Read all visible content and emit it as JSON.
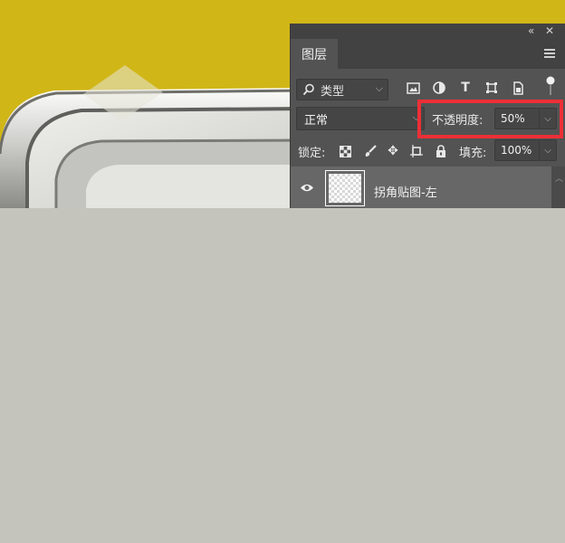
{
  "panel": {
    "collapse_icon": "double-chevron-icon",
    "close_icon": "close-icon",
    "tab_label": "图层",
    "menu_icon": "hamburger-menu-icon"
  },
  "filter": {
    "kind_label": "类型",
    "icons": [
      "image-filter-icon",
      "adjustment-filter-icon",
      "type-filter-icon",
      "shape-filter-icon",
      "smart-object-filter-icon",
      "filter-toggle-icon"
    ]
  },
  "blend": {
    "mode": "正常",
    "opacity_label": "不透明度:",
    "opacity_value": "50%"
  },
  "lock": {
    "label": "锁定:",
    "icons": [
      "lock-transparent-pixels-icon",
      "lock-image-pixels-icon",
      "lock-position-icon",
      "lock-artboard-icon",
      "lock-all-icon"
    ],
    "fill_label": "填充:",
    "fill_value": "100%"
  },
  "layers": [
    {
      "name": "拐角贴图-左",
      "visible": true
    }
  ],
  "colors": {
    "canvas_bg": "#d1b617",
    "panel_bg": "#535353",
    "highlight": "#ec2f37",
    "lower_area": "#c4c4bc"
  }
}
